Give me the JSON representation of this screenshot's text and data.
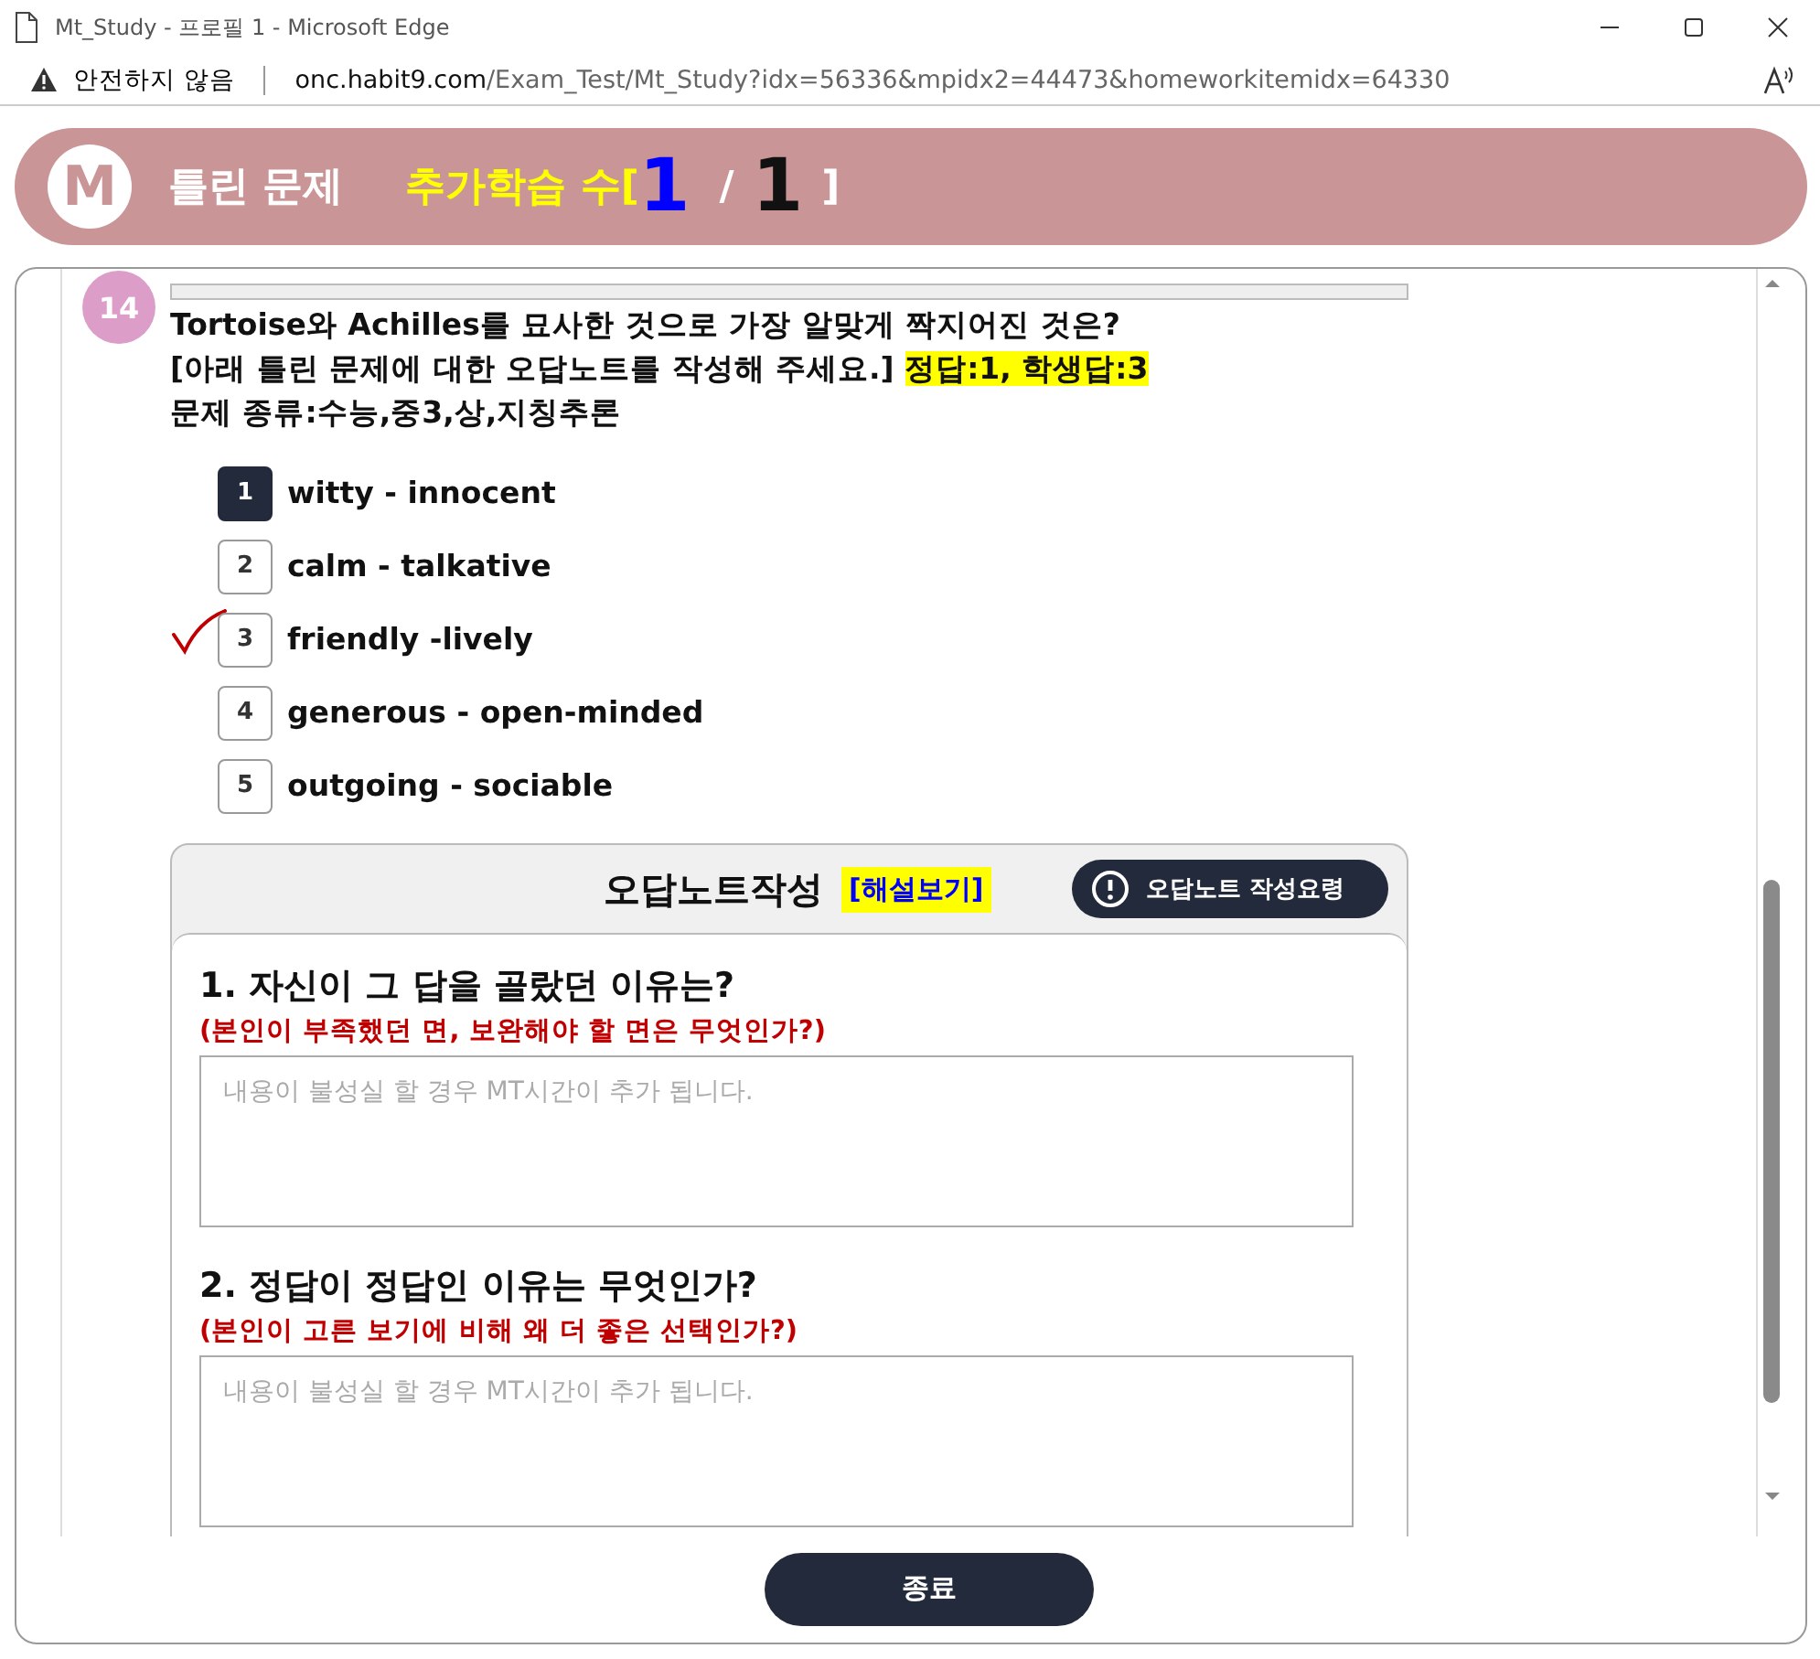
{
  "window": {
    "title": "Mt_Study - 프로필 1 - Microsoft Edge"
  },
  "address_bar": {
    "security": "안전하지 않음",
    "url_host": "onc.habit9.com",
    "url_path": "/Exam_Test/Mt_Study?idx=56336&mpidx2=44473&homeworkitemidx=64330"
  },
  "header": {
    "logo": "M",
    "title": "틀린 문제",
    "extra_label": "추가학습 수[",
    "current": "1",
    "separator": "/",
    "total": "1",
    "bracket": "]"
  },
  "question": {
    "number": "14",
    "text": "Tortoise와 Achilles를 묘사한 것으로 가장 알맞게 짝지어진 것은?",
    "instruction": "[아래 틀린 문제에 대한 오답노트를 작성해 주세요.]",
    "answer_info": "정답:1, 학생답:3",
    "category": "문제 종류:수능,중3,상,지칭추론",
    "choices": [
      {
        "number": "1",
        "text": "witty - innocent",
        "correct": true,
        "student_answer": false
      },
      {
        "number": "2",
        "text": "calm - talkative",
        "correct": false,
        "student_answer": false
      },
      {
        "number": "3",
        "text": "friendly -lively",
        "correct": false,
        "student_answer": true
      },
      {
        "number": "4",
        "text": "generous - open-minded",
        "correct": false,
        "student_answer": false
      },
      {
        "number": "5",
        "text": "outgoing - sociable",
        "correct": false,
        "student_answer": false
      }
    ]
  },
  "note": {
    "title": "오답노트작성",
    "explanation_link": "[해설보기]",
    "guide_button": "오답노트 작성요령",
    "sections": [
      {
        "title": "1. 자신이 그 답을 골랐던 이유는?",
        "hint": "(본인이 부족했던 면, 보완해야 할 면은 무엇인가?)",
        "placeholder": "내용이 불성실 할 경우 MT시간이 추가 됩니다."
      },
      {
        "title": "2. 정답이 정답인 이유는 무엇인가?",
        "hint": "(본인이 고른 보기에 비해 왜 더 좋은 선택인가?)",
        "placeholder": "내용이 불성실 할 경우 MT시간이 추가 됩니다."
      }
    ]
  },
  "footer": {
    "end_button": "종료"
  }
}
